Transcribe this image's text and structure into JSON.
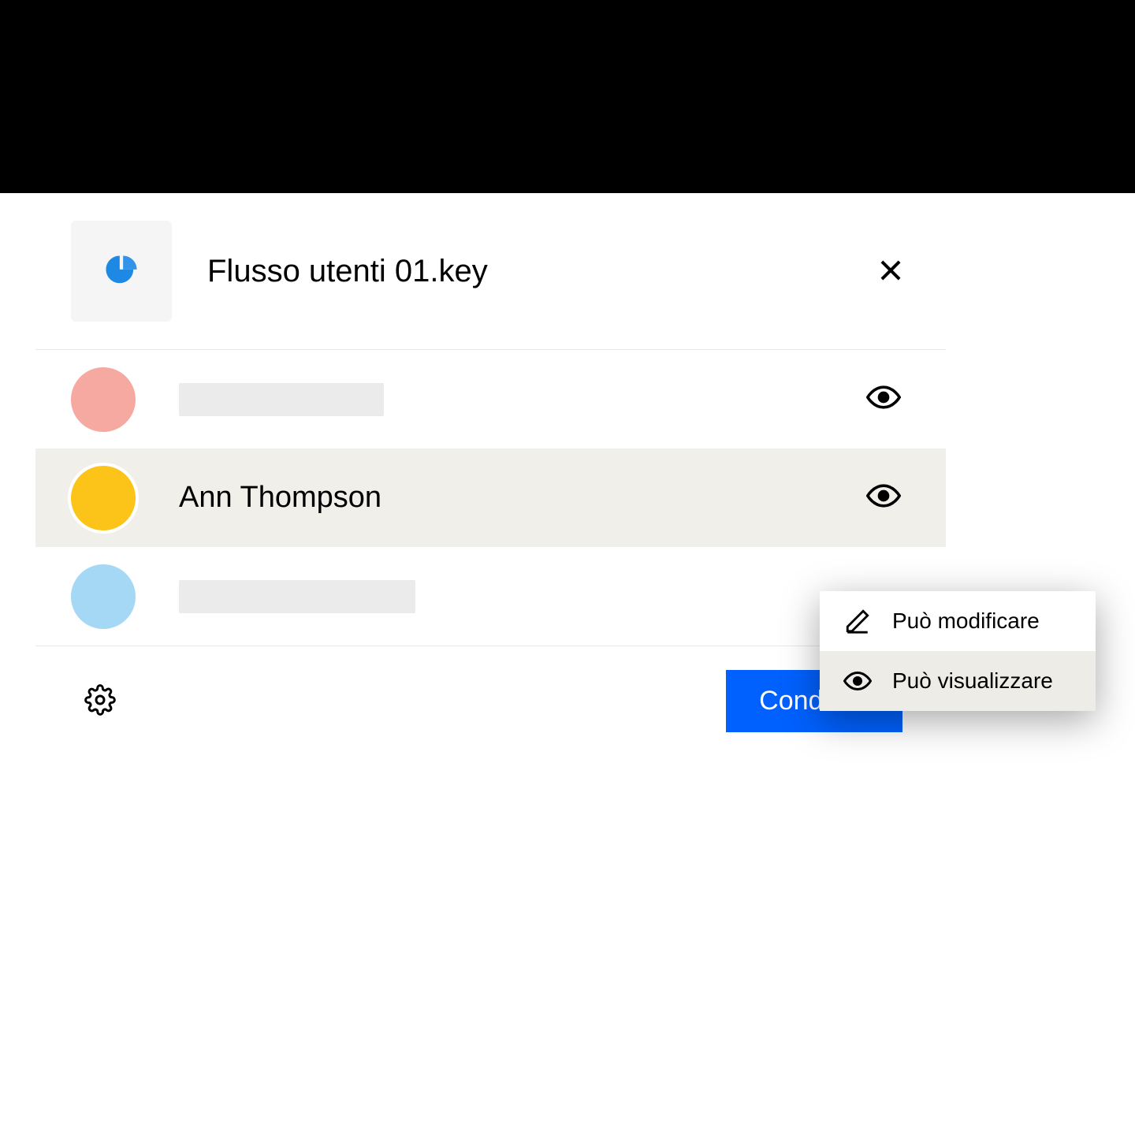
{
  "header": {
    "file_title": "Flusso utenti 01.key",
    "file_icon_name": "pie-chart-icon",
    "close_label": "close"
  },
  "users": [
    {
      "name": "",
      "avatar_color": "pink",
      "permission": "view",
      "selected": false,
      "placeholder": true
    },
    {
      "name": "Ann Thompson",
      "avatar_color": "yellow",
      "permission": "view",
      "selected": true,
      "placeholder": false
    },
    {
      "name": "",
      "avatar_color": "blue",
      "permission": "",
      "selected": false,
      "placeholder": true
    }
  ],
  "dropdown": {
    "items": [
      {
        "label": "Può modificare",
        "icon": "edit-icon",
        "active": false
      },
      {
        "label": "Può visualizzare",
        "icon": "eye-icon",
        "active": true
      }
    ]
  },
  "footer": {
    "settings_label": "settings",
    "share_label": "Condividi"
  }
}
